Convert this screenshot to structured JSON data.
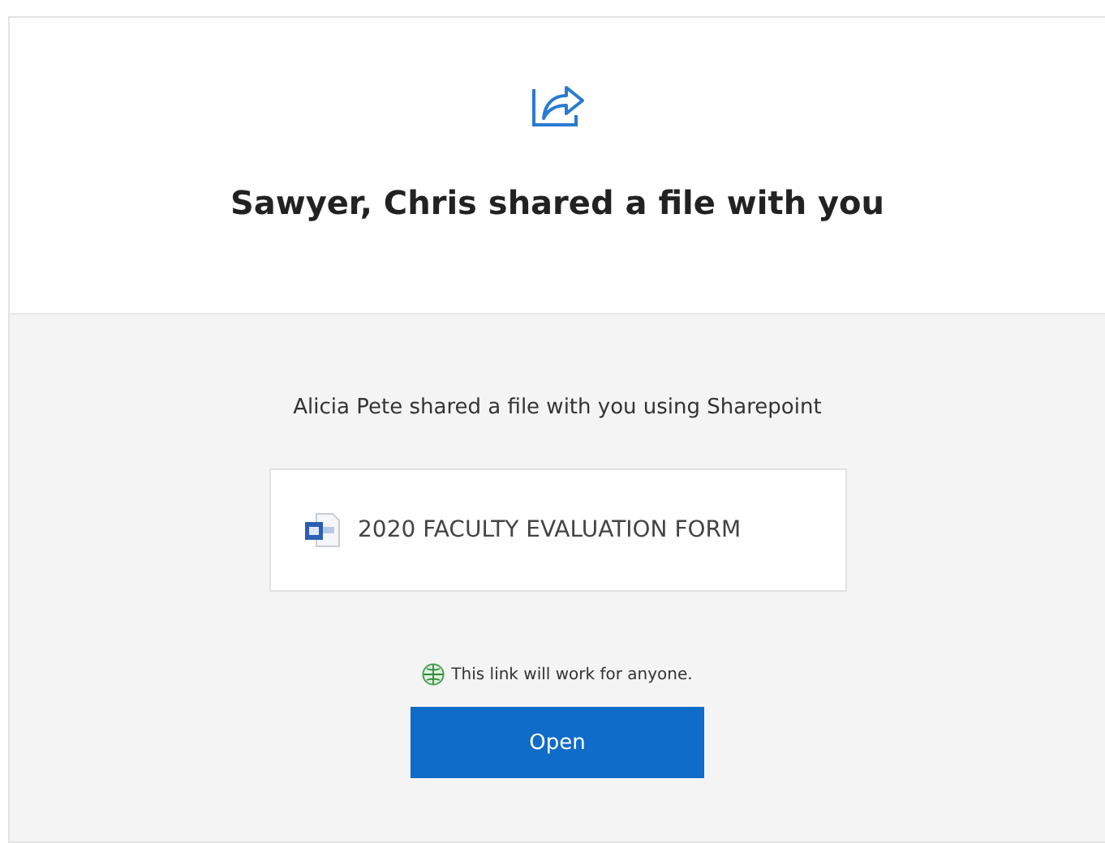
{
  "header": {
    "title": "Sawyer, Chris shared a file with you"
  },
  "message": "Alicia Pete shared a file with you using Sharepoint",
  "file": {
    "name": "2020 FACULTY EVALUATION FORM"
  },
  "link_note": "This link will work for anyone.",
  "button": "Open"
}
